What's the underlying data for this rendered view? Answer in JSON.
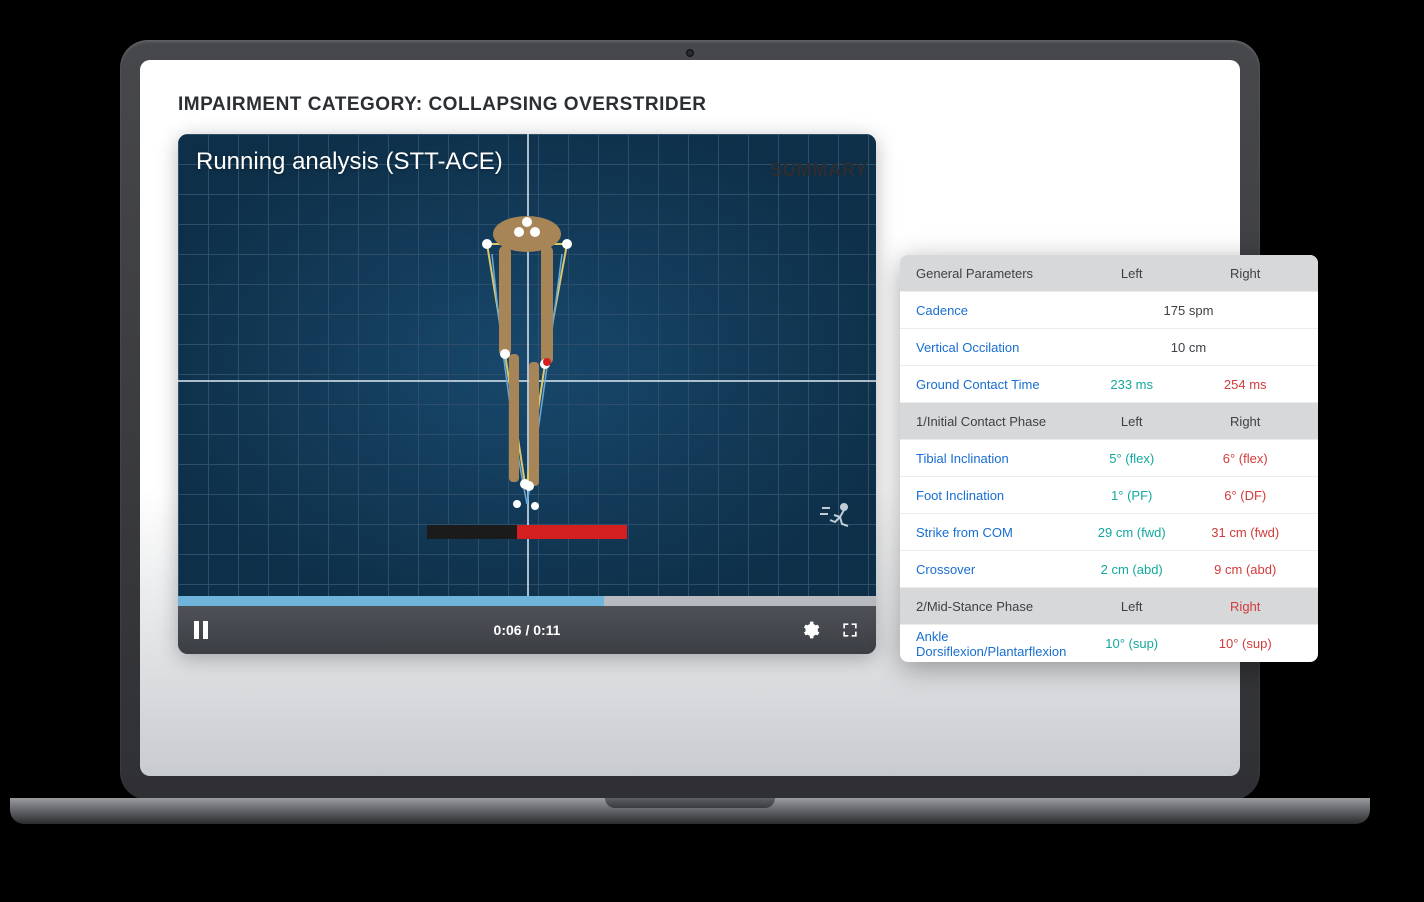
{
  "page": {
    "title": "IMPAIRMENT CATEGORY: COLLAPSING OVERSTRIDER"
  },
  "video": {
    "overlay_title": "Running analysis (STT-ACE)",
    "time_current": "0:06",
    "time_total": "0:11",
    "time_display": "0:06 / 0:11",
    "progress_percent": 61
  },
  "summary": {
    "heading": "SUMMARY",
    "sections": [
      {
        "header": {
          "name": "General Parameters",
          "left": "Left",
          "right": "Right"
        },
        "rows": [
          {
            "name": "Cadence",
            "combined": "175 spm"
          },
          {
            "name": "Vertical Occilation",
            "combined": "10 cm"
          },
          {
            "name": "Ground Contact Time",
            "left": "233 ms",
            "right": "254 ms",
            "left_color": "teal",
            "right_color": "red"
          }
        ]
      },
      {
        "header": {
          "name": "1/Initial Contact Phase",
          "left": "Left",
          "right": "Right"
        },
        "rows": [
          {
            "name": "Tibial Inclination",
            "left": "5° (flex)",
            "right": "6° (flex)",
            "left_color": "teal",
            "right_color": "red"
          },
          {
            "name": "Foot Inclination",
            "left": "1° (PF)",
            "right": "6° (DF)",
            "left_color": "teal",
            "right_color": "red"
          },
          {
            "name": "Strike from COM",
            "left": "29 cm (fwd)",
            "right": "31 cm (fwd)",
            "left_color": "teal",
            "right_color": "red"
          },
          {
            "name": "Crossover",
            "left": "2 cm (abd)",
            "right": "9 cm (abd)",
            "left_color": "teal",
            "right_color": "red"
          }
        ]
      },
      {
        "header": {
          "name": "2/Mid-Stance Phase",
          "left": "Left",
          "right": "Right",
          "right_color": "red"
        },
        "rows": [
          {
            "name": "Ankle Dorsiflexion/Plantarflexion",
            "left": "10° (sup)",
            "right": "10° (sup)",
            "left_color": "teal",
            "right_color": "red"
          }
        ]
      }
    ]
  }
}
